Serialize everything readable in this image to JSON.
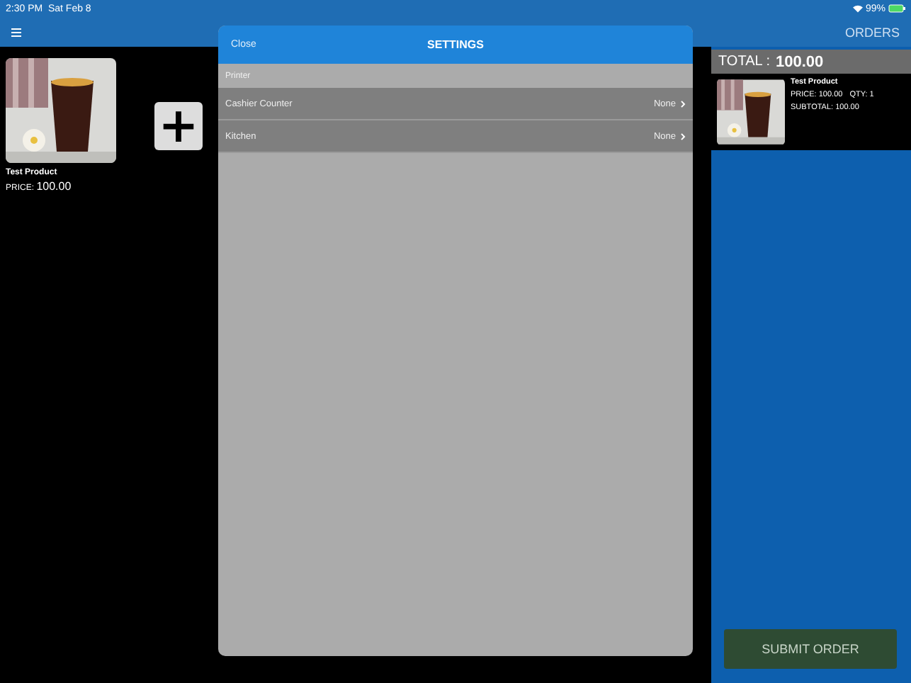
{
  "status_bar": {
    "time": "2:30 PM",
    "date": "Sat Feb 8",
    "battery": "99%"
  },
  "nav": {
    "orders": "ORDERS"
  },
  "products": [
    {
      "name": "Test Product",
      "price_label": "PRICE:",
      "price": "100.00"
    }
  ],
  "add_button": {
    "label": "+"
  },
  "cart": {
    "total_label": "TOTAL :",
    "total": "100.00",
    "items": [
      {
        "name": "Test Product",
        "price": "PRICE: 100.00",
        "qty": "QTY: 1",
        "subtotal": "SUBTOTAL: 100.00"
      }
    ],
    "submit": "SUBMIT ORDER"
  },
  "dialog": {
    "title": "SETTINGS",
    "close": "Close",
    "section": "Printer",
    "rows": [
      {
        "label": "Cashier Counter",
        "value": "None"
      },
      {
        "label": "Kitchen",
        "value": "None"
      }
    ]
  }
}
